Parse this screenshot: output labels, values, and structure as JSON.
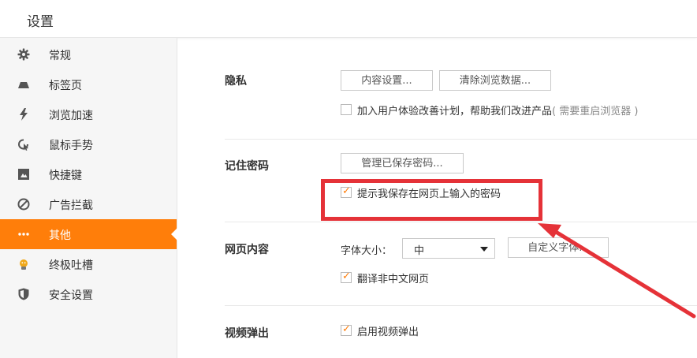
{
  "header": {
    "title": "设置"
  },
  "sidebar": {
    "active_index": 6,
    "items": [
      {
        "label": "常规",
        "icon": "gear-icon"
      },
      {
        "label": "标签页",
        "icon": "tab-icon"
      },
      {
        "label": "浏览加速",
        "icon": "lightning-icon"
      },
      {
        "label": "鼠标手势",
        "icon": "mouse-gesture-icon"
      },
      {
        "label": "快捷键",
        "icon": "keyboard-shortcut-icon"
      },
      {
        "label": "广告拦截",
        "icon": "block-icon"
      },
      {
        "label": "其他",
        "icon": "more-dots-icon"
      },
      {
        "label": "终极吐槽",
        "icon": "feedback-icon"
      },
      {
        "label": "安全设置",
        "icon": "shield-icon"
      }
    ]
  },
  "privacy": {
    "title": "隐私",
    "content_settings_button": "内容设置...",
    "clear_data_button": "清除浏览数据...",
    "ux_plan": {
      "checked": false,
      "label": "加入用户体验改善计划，帮助我们改进产品",
      "hint": "( 需要重启浏览器 )"
    }
  },
  "passwords": {
    "title": "记住密码",
    "manage_button": "管理已保存密码...",
    "prompt_save": {
      "checked": true,
      "label": "提示我保存在网页上输入的密码"
    }
  },
  "web_content": {
    "title": "网页内容",
    "font_size_label": "字体大小：",
    "font_size_value": "中",
    "custom_font_button": "自定义字体...",
    "translate": {
      "checked": true,
      "label": "翻译非中文网页"
    }
  },
  "video_popup": {
    "title": "视频弹出",
    "enable": {
      "checked": true,
      "label": "启用视频弹出"
    }
  },
  "colors": {
    "accent": "#ff7e0a",
    "annotation": "#e53238"
  }
}
